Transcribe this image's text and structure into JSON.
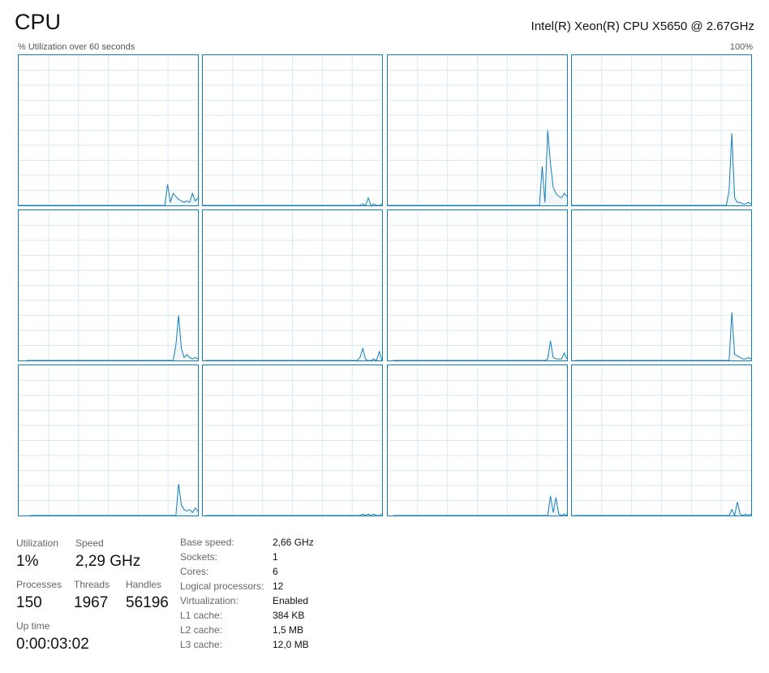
{
  "header": {
    "title": "CPU",
    "cpu_name": "Intel(R) Xeon(R) CPU X5650 @ 2.67GHz",
    "utilization_caption": "% Utilization over 60 seconds",
    "max_label": "100%"
  },
  "colors": {
    "graph_line": "#117dbb",
    "graph_fill": "#f1f6fa",
    "grid": "#d9eaf4",
    "border": "#117dbb"
  },
  "graphs": [
    {
      "name": "logical-processor-1",
      "values": [
        0,
        0,
        0,
        0,
        0,
        0,
        0,
        0,
        0,
        0,
        0,
        0,
        0,
        0,
        0,
        0,
        0,
        0,
        0,
        0,
        0,
        0,
        0,
        0,
        0,
        0,
        0,
        0,
        0,
        0,
        0,
        0,
        0,
        0,
        0,
        0,
        0,
        0,
        0,
        0,
        0,
        0,
        0,
        0,
        0,
        0,
        0,
        0,
        0,
        0,
        0,
        0,
        0,
        0,
        14,
        2,
        8,
        6,
        4,
        3,
        2,
        3,
        2,
        8,
        3,
        5
      ]
    },
    {
      "name": "logical-processor-2",
      "values": [
        0,
        0,
        0,
        0,
        0,
        0,
        0,
        0,
        0,
        0,
        0,
        0,
        0,
        0,
        0,
        0,
        0,
        0,
        0,
        0,
        0,
        0,
        0,
        0,
        0,
        0,
        0,
        0,
        0,
        0,
        0,
        0,
        0,
        0,
        0,
        0,
        0,
        0,
        0,
        0,
        0,
        0,
        0,
        0,
        0,
        0,
        0,
        0,
        0,
        0,
        0,
        0,
        0,
        0,
        0,
        0,
        0,
        0,
        1,
        0,
        5,
        0,
        1,
        0,
        0,
        1
      ]
    },
    {
      "name": "logical-processor-3",
      "values": [
        0,
        0,
        0,
        0,
        0,
        0,
        0,
        0,
        0,
        0,
        0,
        0,
        0,
        0,
        0,
        0,
        0,
        0,
        0,
        0,
        0,
        0,
        0,
        0,
        0,
        0,
        0,
        0,
        0,
        0,
        0,
        0,
        0,
        0,
        0,
        0,
        0,
        0,
        0,
        0,
        0,
        0,
        0,
        0,
        0,
        0,
        0,
        0,
        0,
        0,
        0,
        0,
        0,
        0,
        0,
        0,
        0,
        0,
        0,
        26,
        2,
        50,
        28,
        12,
        8,
        6,
        5,
        8,
        6
      ]
    },
    {
      "name": "logical-processor-4",
      "values": [
        0,
        0,
        0,
        0,
        0,
        0,
        0,
        0,
        0,
        0,
        0,
        0,
        0,
        0,
        0,
        0,
        0,
        0,
        0,
        0,
        0,
        0,
        0,
        0,
        0,
        0,
        0,
        0,
        0,
        0,
        0,
        0,
        0,
        0,
        0,
        0,
        0,
        0,
        0,
        0,
        0,
        0,
        0,
        0,
        0,
        0,
        0,
        0,
        0,
        0,
        0,
        0,
        0,
        0,
        0,
        0,
        0,
        10,
        48,
        5,
        2,
        2,
        1,
        1,
        2,
        1
      ]
    },
    {
      "name": "logical-processor-5",
      "values": [
        0,
        0,
        0,
        0,
        0,
        0,
        0,
        0,
        0,
        0,
        0,
        0,
        0,
        0,
        0,
        0,
        0,
        0,
        0,
        0,
        0,
        0,
        0,
        0,
        0,
        0,
        0,
        0,
        0,
        0,
        0,
        0,
        0,
        0,
        0,
        0,
        0,
        0,
        0,
        0,
        0,
        0,
        0,
        0,
        0,
        0,
        0,
        0,
        0,
        0,
        0,
        0,
        0,
        0,
        10,
        30,
        8,
        2,
        4,
        2,
        1,
        2,
        1
      ]
    },
    {
      "name": "logical-processor-6",
      "values": [
        0,
        0,
        0,
        0,
        0,
        0,
        0,
        0,
        0,
        0,
        0,
        0,
        0,
        0,
        0,
        0,
        0,
        0,
        0,
        0,
        0,
        0,
        0,
        0,
        0,
        0,
        0,
        0,
        0,
        0,
        0,
        0,
        0,
        0,
        0,
        0,
        0,
        0,
        0,
        0,
        0,
        0,
        0,
        0,
        0,
        0,
        0,
        0,
        0,
        0,
        0,
        0,
        0,
        0,
        0,
        0,
        2,
        8,
        1,
        0,
        0,
        1,
        0,
        6,
        0
      ]
    },
    {
      "name": "logical-processor-7",
      "values": [
        0,
        0,
        0,
        0,
        0,
        0,
        0,
        0,
        0,
        0,
        0,
        0,
        0,
        0,
        0,
        0,
        0,
        0,
        0,
        0,
        0,
        0,
        0,
        0,
        0,
        0,
        0,
        0,
        0,
        0,
        0,
        0,
        0,
        0,
        0,
        0,
        0,
        0,
        0,
        0,
        0,
        0,
        0,
        0,
        0,
        0,
        0,
        0,
        0,
        0,
        0,
        0,
        0,
        0,
        0,
        0,
        1,
        13,
        2,
        1,
        1,
        1,
        5,
        1
      ]
    },
    {
      "name": "logical-processor-8",
      "values": [
        0,
        0,
        0,
        0,
        0,
        0,
        0,
        0,
        0,
        0,
        0,
        0,
        0,
        0,
        0,
        0,
        0,
        0,
        0,
        0,
        0,
        0,
        0,
        0,
        0,
        0,
        0,
        0,
        0,
        0,
        0,
        0,
        0,
        0,
        0,
        0,
        0,
        0,
        0,
        0,
        0,
        0,
        0,
        0,
        0,
        0,
        0,
        0,
        0,
        0,
        0,
        0,
        0,
        0,
        0,
        0,
        0,
        32,
        4,
        3,
        2,
        1,
        1,
        2,
        1
      ]
    },
    {
      "name": "logical-processor-9",
      "values": [
        0,
        0,
        0,
        0,
        0,
        0,
        0,
        0,
        0,
        0,
        0,
        0,
        0,
        0,
        0,
        0,
        0,
        0,
        0,
        0,
        0,
        0,
        0,
        0,
        0,
        0,
        0,
        0,
        0,
        0,
        0,
        0,
        0,
        0,
        0,
        0,
        0,
        0,
        0,
        0,
        0,
        0,
        0,
        0,
        0,
        0,
        0,
        0,
        0,
        0,
        0,
        0,
        0,
        0,
        21,
        7,
        4,
        3,
        4,
        2,
        5,
        3
      ]
    },
    {
      "name": "logical-processor-10",
      "values": [
        0,
        0,
        0,
        0,
        0,
        0,
        0,
        0,
        0,
        0,
        0,
        0,
        0,
        0,
        0,
        0,
        0,
        0,
        0,
        0,
        0,
        0,
        0,
        0,
        0,
        0,
        0,
        0,
        0,
        0,
        0,
        0,
        0,
        0,
        0,
        0,
        0,
        0,
        0,
        0,
        0,
        0,
        0,
        0,
        0,
        0,
        0,
        0,
        0,
        0,
        0,
        0,
        0,
        0,
        0,
        0,
        0,
        1,
        0,
        1,
        0,
        1,
        0,
        0,
        1
      ]
    },
    {
      "name": "logical-processor-11",
      "values": [
        0,
        0,
        0,
        0,
        0,
        0,
        0,
        0,
        0,
        0,
        0,
        0,
        0,
        0,
        0,
        0,
        0,
        0,
        0,
        0,
        0,
        0,
        0,
        0,
        0,
        0,
        0,
        0,
        0,
        0,
        0,
        0,
        0,
        0,
        0,
        0,
        0,
        0,
        0,
        0,
        0,
        0,
        0,
        0,
        0,
        0,
        0,
        0,
        0,
        0,
        0,
        0,
        0,
        0,
        0,
        0,
        0,
        13,
        2,
        12,
        1,
        0,
        1,
        0
      ]
    },
    {
      "name": "logical-processor-12",
      "values": [
        0,
        0,
        0,
        0,
        0,
        0,
        0,
        0,
        0,
        0,
        0,
        0,
        0,
        0,
        0,
        0,
        0,
        0,
        0,
        0,
        0,
        0,
        0,
        0,
        0,
        0,
        0,
        0,
        0,
        0,
        0,
        0,
        0,
        0,
        0,
        0,
        0,
        0,
        0,
        0,
        0,
        0,
        0,
        0,
        0,
        0,
        0,
        0,
        0,
        0,
        0,
        0,
        0,
        0,
        0,
        0,
        0,
        4,
        0,
        9,
        1,
        0,
        1,
        0,
        1
      ]
    }
  ],
  "stats": {
    "utilization_label": "Utilization",
    "utilization_value": "1%",
    "speed_label": "Speed",
    "speed_value": "2,29 GHz",
    "processes_label": "Processes",
    "processes_value": "150",
    "threads_label": "Threads",
    "threads_value": "1967",
    "handles_label": "Handles",
    "handles_value": "56196",
    "uptime_label": "Up time",
    "uptime_value": "0:00:03:02"
  },
  "details": [
    {
      "label": "Base speed:",
      "value": "2,66 GHz"
    },
    {
      "label": "Sockets:",
      "value": "1"
    },
    {
      "label": "Cores:",
      "value": "6"
    },
    {
      "label": "Logical processors:",
      "value": "12"
    },
    {
      "label": "Virtualization:",
      "value": "Enabled"
    },
    {
      "label": "L1 cache:",
      "value": "384 KB"
    },
    {
      "label": "L2 cache:",
      "value": "1,5 MB"
    },
    {
      "label": "L3 cache:",
      "value": "12,0 MB"
    }
  ]
}
